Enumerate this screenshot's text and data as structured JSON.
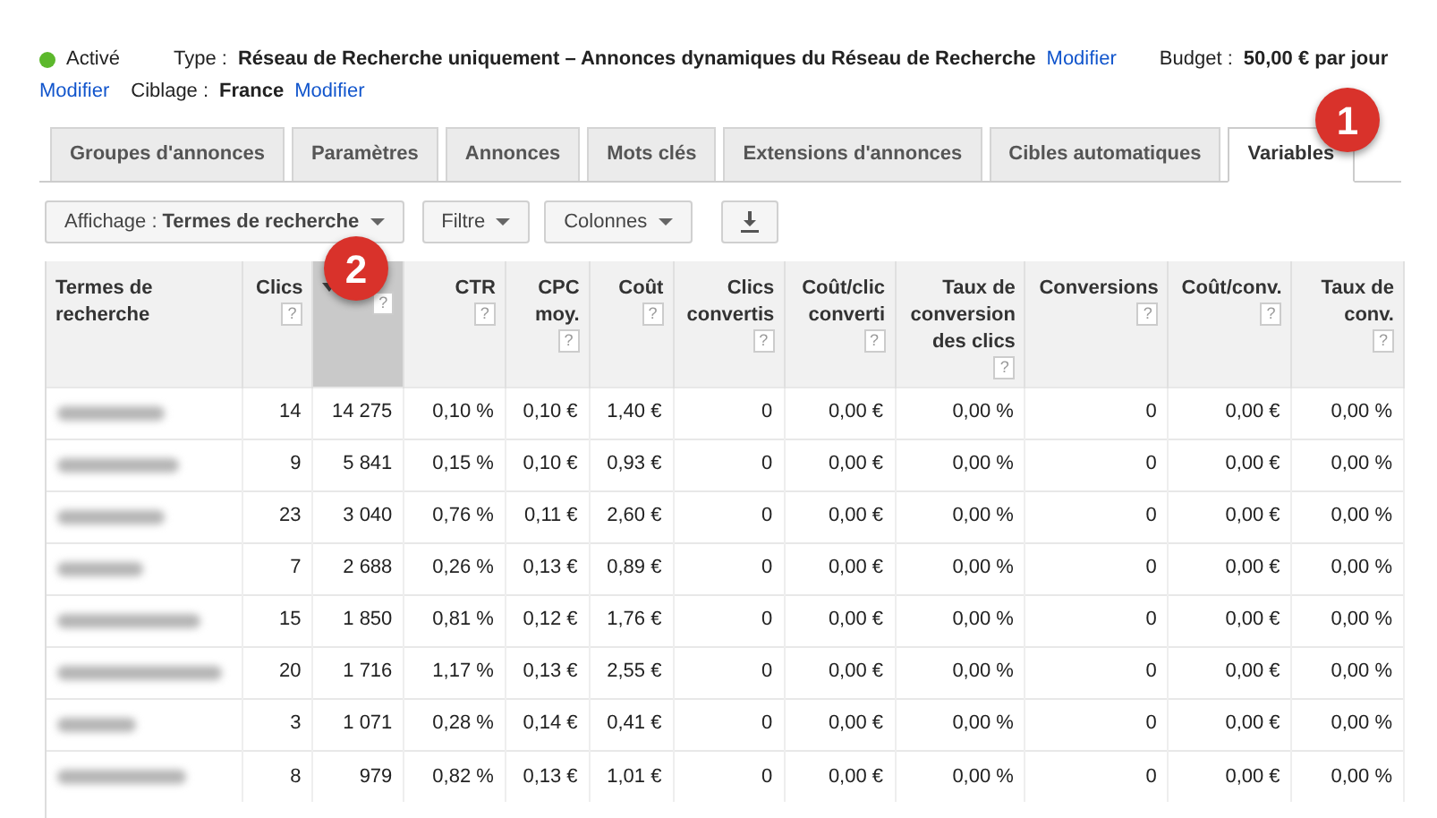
{
  "summary": {
    "status": {
      "label": "Activé",
      "active": true
    },
    "type_label": "Type :",
    "type_value": "Réseau de Recherche uniquement – Annonces dynamiques du Réseau de Recherche",
    "type_link": "Modifier",
    "budget_label": "Budget :",
    "budget_value": "50,00 € par jour",
    "budget_link": "Modifier",
    "targeting_label": "Ciblage :",
    "targeting_value": "France",
    "targeting_link": "Modifier"
  },
  "tabs": [
    {
      "label": "Groupes d'annonces",
      "selected": false
    },
    {
      "label": "Paramètres",
      "selected": false
    },
    {
      "label": "Annonces",
      "selected": false
    },
    {
      "label": "Mots clés",
      "selected": false
    },
    {
      "label": "Extensions d'annonces",
      "selected": false
    },
    {
      "label": "Cibles automatiques",
      "selected": false
    },
    {
      "label": "Variables",
      "selected": true
    }
  ],
  "callouts": [
    "1",
    "2"
  ],
  "toolbar": {
    "view_label": "Affichage :",
    "view_value": "Termes de recherche",
    "filter": "Filtre",
    "columns": "Colonnes"
  },
  "table": {
    "columns": [
      {
        "label": "Termes de recherche",
        "sorted": false
      },
      {
        "label": "Clics",
        "help": "?",
        "sorted": false
      },
      {
        "sorted": true,
        "help": "?"
      },
      {
        "label": "CTR",
        "help": "?",
        "sorted": false
      },
      {
        "label": "CPC moy.",
        "help": "?",
        "sorted": false
      },
      {
        "label": "Coût",
        "help": "?",
        "sorted": false
      },
      {
        "label": "Clics convertis",
        "help": "?",
        "sorted": false
      },
      {
        "label": "Coût/clic converti",
        "help": "?",
        "sorted": false
      },
      {
        "label": "Taux de conversion des clics",
        "help": "?",
        "sorted": false
      },
      {
        "label": "Conversions",
        "help": "?",
        "sorted": false
      },
      {
        "label": "Coût/conv.",
        "help": "?",
        "sorted": false
      },
      {
        "label": "Taux de conv.",
        "help": "?",
        "sorted": false
      }
    ],
    "rows": [
      [
        "",
        "14",
        "14 275",
        "0,10 %",
        "0,10 €",
        "1,40 €",
        "0",
        "0,00 €",
        "0,00 %",
        "0",
        "0,00 €",
        "0,00 %"
      ],
      [
        "",
        "9",
        "5 841",
        "0,15 %",
        "0,10 €",
        "0,93 €",
        "0",
        "0,00 €",
        "0,00 %",
        "0",
        "0,00 €",
        "0,00 %"
      ],
      [
        "",
        "23",
        "3 040",
        "0,76 %",
        "0,11 €",
        "2,60 €",
        "0",
        "0,00 €",
        "0,00 %",
        "0",
        "0,00 €",
        "0,00 %"
      ],
      [
        "",
        "7",
        "2 688",
        "0,26 %",
        "0,13 €",
        "0,89 €",
        "0",
        "0,00 €",
        "0,00 %",
        "0",
        "0,00 €",
        "0,00 %"
      ],
      [
        "",
        "15",
        "1 850",
        "0,81 %",
        "0,12 €",
        "1,76 €",
        "0",
        "0,00 €",
        "0,00 %",
        "0",
        "0,00 €",
        "0,00 %"
      ],
      [
        "",
        "20",
        "1 716",
        "1,17 %",
        "0,13 €",
        "2,55 €",
        "0",
        "0,00 €",
        "0,00 %",
        "0",
        "0,00 €",
        "0,00 %"
      ],
      [
        "",
        "3",
        "1 071",
        "0,28 %",
        "0,14 €",
        "0,41 €",
        "0",
        "0,00 €",
        "0,00 %",
        "0",
        "0,00 €",
        "0,00 %"
      ],
      [
        "",
        "8",
        "979",
        "0,82 %",
        "0,13 €",
        "1,01 €",
        "0",
        "0,00 €",
        "0,00 %",
        "0",
        "0,00 €",
        "0,00 %"
      ]
    ]
  }
}
